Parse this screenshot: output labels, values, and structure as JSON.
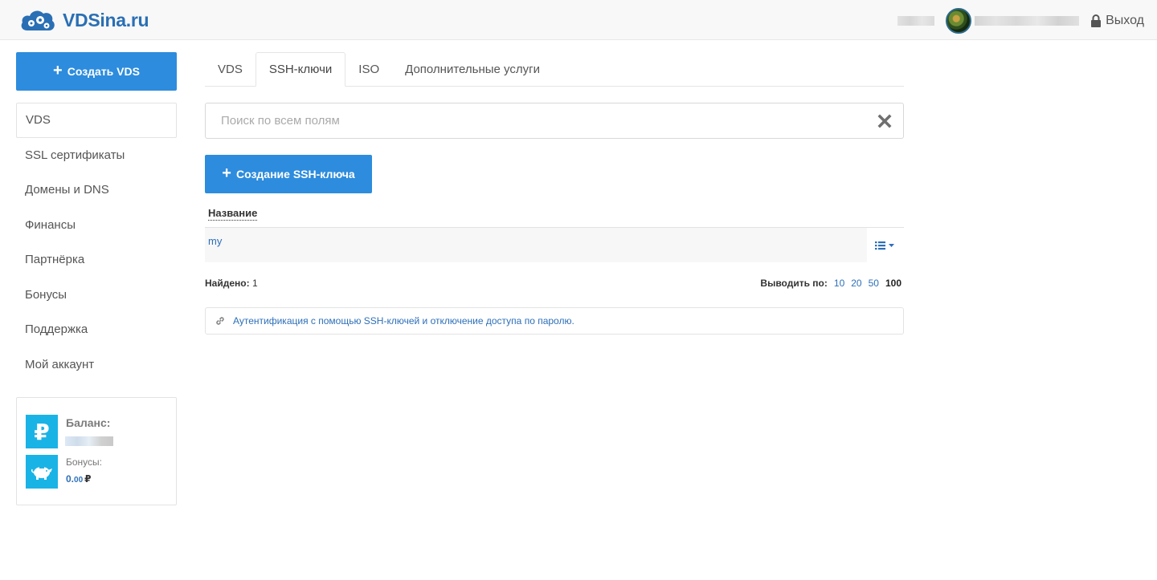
{
  "header": {
    "logo_text": "VDSina.ru",
    "logout_label": "Выход"
  },
  "sidebar": {
    "create_button_label": "Создать VDS",
    "items": [
      {
        "label": "VDS",
        "active": true
      },
      {
        "label": "SSL сертификаты"
      },
      {
        "label": "Домены и DNS"
      },
      {
        "label": "Финансы"
      },
      {
        "label": "Партнёрка"
      },
      {
        "label": "Бонусы"
      },
      {
        "label": "Поддержка"
      },
      {
        "label": "Мой аккаунт"
      }
    ],
    "balance": {
      "balance_label": "Баланс:",
      "bonuses_label": "Бонусы:",
      "bonuses_int": "0.",
      "bonuses_frac": "00",
      "currency": "₽"
    }
  },
  "tabs": [
    {
      "label": "VDS"
    },
    {
      "label": "SSH-ключи",
      "active": true
    },
    {
      "label": "ISO"
    },
    {
      "label": "Дополнительные услуги"
    }
  ],
  "search": {
    "placeholder": "Поиск по всем полям"
  },
  "create_key_label": "Создание SSH-ключа",
  "table": {
    "column_header": "Название",
    "rows": [
      {
        "name": "my"
      }
    ]
  },
  "footer": {
    "found_label": "Найдено:",
    "found_count": "1",
    "per_page_label": "Выводить по:",
    "per_page_options": [
      "10",
      "20",
      "50"
    ],
    "per_page_current": "100"
  },
  "info_link_text": "Аутентификация с помощью SSH-ключей и отключение доступа по паролю.",
  "colors": {
    "primary": "#2d8cdd",
    "link": "#2d6fb8",
    "logo": "#2a6fb4",
    "icon_bg": "#1ab3e6"
  }
}
